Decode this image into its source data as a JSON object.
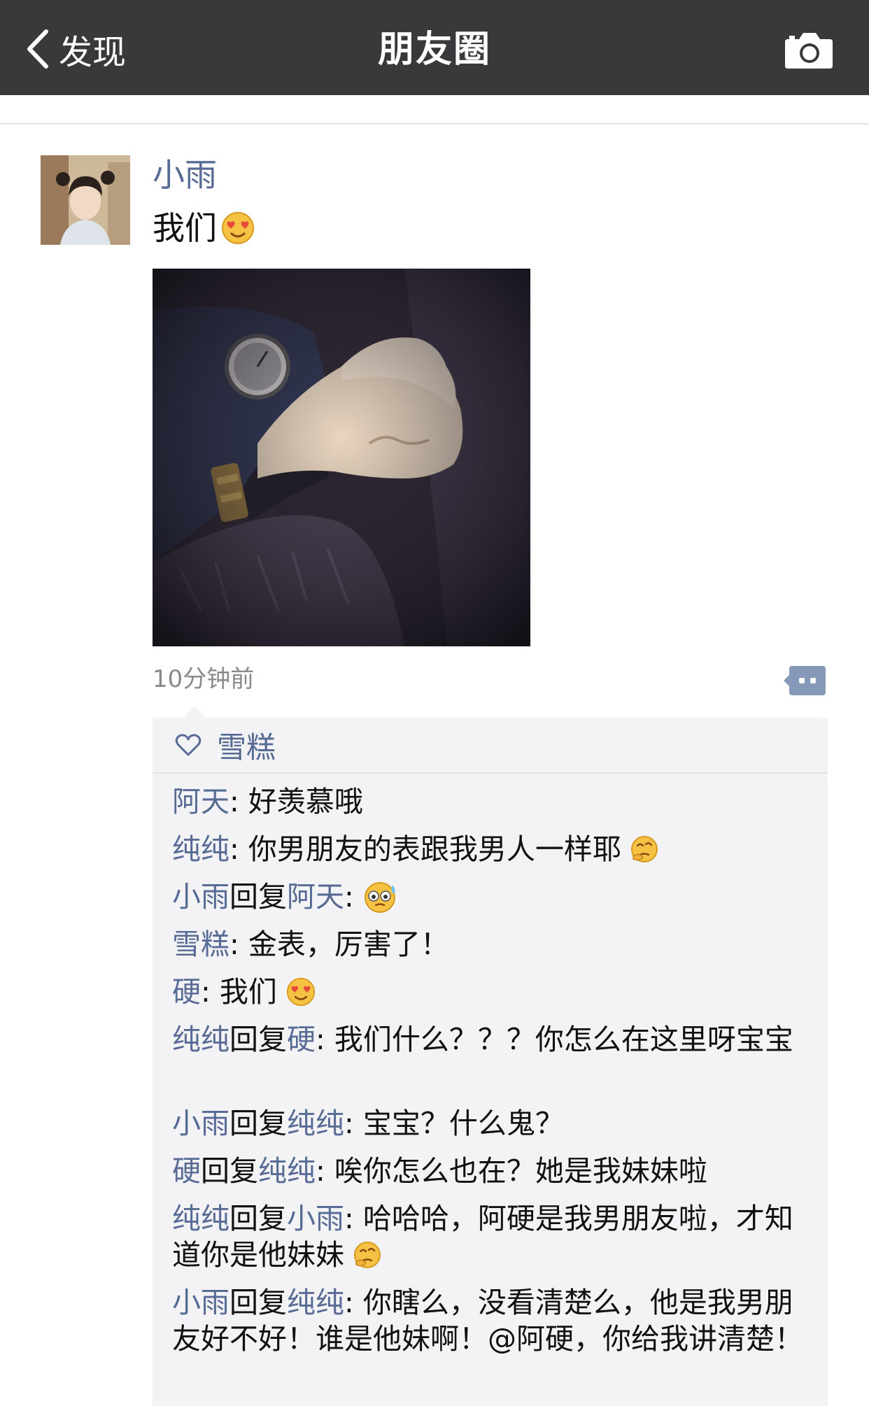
{
  "nav": {
    "back_label": "发现",
    "title": "朋友圈"
  },
  "post": {
    "author": "小雨",
    "text": "我们",
    "text_emoji": "heart-eyes-emoji",
    "time": "10分钟前"
  },
  "likes": {
    "names": "雪糕"
  },
  "comments": [
    {
      "from": "阿天",
      "text": "好羡慕哦"
    },
    {
      "from": "纯纯",
      "text": "你男朋友的表跟我男人一样耶",
      "emoji": "thinking-emoji"
    },
    {
      "from": "小雨",
      "reply_word": "回复",
      "to": "阿天",
      "text": "",
      "emoji": "nervous-emoji"
    },
    {
      "from": "雪糕",
      "text": "金表，厉害了！"
    },
    {
      "from": "硬",
      "text": "我们",
      "emoji": "heart-eyes-emoji"
    },
    {
      "from": "纯纯",
      "reply_word": "回复",
      "to": "硬",
      "text": "我们什么？？？你怎么在这里呀宝宝"
    },
    {
      "from": "小雨",
      "reply_word": "回复",
      "to": "纯纯",
      "text": "宝宝？什么鬼？"
    },
    {
      "from": "硬",
      "reply_word": "回复",
      "to": "纯纯",
      "text": "唉你怎么也在？她是我妹妹啦"
    },
    {
      "from": "纯纯",
      "reply_word": "回复",
      "to": "小雨",
      "text": "哈哈哈，阿硬是我男朋友啦，才知道你是他妹妹",
      "emoji": "thinking-emoji"
    },
    {
      "from": "小雨",
      "reply_word": "回复",
      "to": "纯纯",
      "text": "你瞎么，没看清楚么，他是我男朋友好不好！谁是他妹啊！@阿硬，你给我讲清楚！"
    }
  ],
  "colors": {
    "navbar": "#39393c",
    "link": "#576b95",
    "comments_bg": "#f3f3f5"
  }
}
